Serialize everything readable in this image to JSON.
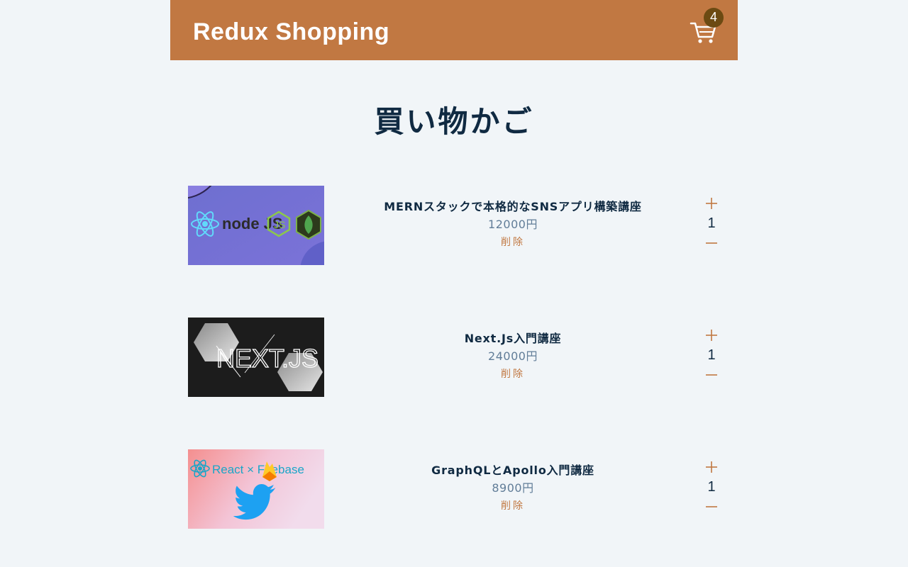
{
  "header": {
    "brand": "Redux Shopping",
    "cart_count": "4",
    "accent_color": "#c17842",
    "badge_color": "#6c4a12"
  },
  "page": {
    "title": "買い物かご"
  },
  "cart": {
    "items": [
      {
        "name": "MERNスタックで本格的なSNSアプリ構築講座",
        "price": "12000円",
        "quantity": "1",
        "remove_label": "削除",
        "image_text": "node JS",
        "image_icons": [
          "react-logo-icon",
          "nodejs-logo-icon",
          "js-logo-icon",
          "mongodb-leaf-icon"
        ]
      },
      {
        "name": "Next.Js入門講座",
        "price": "24000円",
        "quantity": "1",
        "remove_label": "削除",
        "image_text": "NEXT.JS",
        "image_icons": [
          "hexagon-icon"
        ]
      },
      {
        "name": "GraphQLとApollo入門講座",
        "price": "8900円",
        "quantity": "1",
        "remove_label": "削除",
        "image_text": "React × Firebase",
        "image_icons": [
          "react-logo-icon",
          "firebase-flame-icon",
          "twitter-bird-icon"
        ]
      }
    ]
  },
  "icons": {
    "cart": "cart-icon",
    "increase": "plus-icon",
    "decrease": "minus-icon"
  }
}
